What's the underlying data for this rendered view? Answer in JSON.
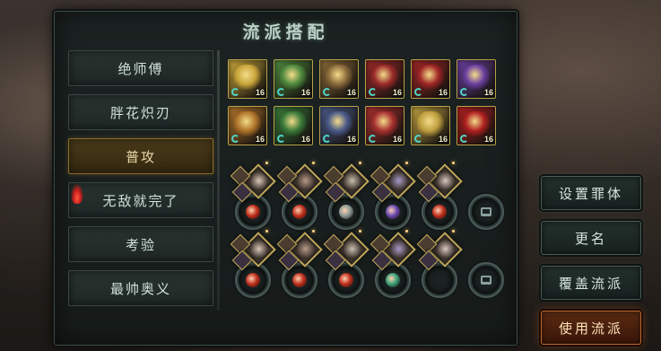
{
  "title": "流派搭配",
  "tabs": [
    "绝师傅",
    "胖花炽刃",
    "普攻",
    "无敌就完了",
    "考验",
    "最帅奥义"
  ],
  "active_tab": "普攻",
  "equipment": {
    "rows": [
      [
        {
          "name": "golden-bell-relic",
          "level": "16",
          "color": "#c9a63a"
        },
        {
          "name": "jade-gauntlet",
          "level": "16",
          "color": "#4f8a3e"
        },
        {
          "name": "bronze-armor",
          "level": "16",
          "color": "#8a6a3a"
        },
        {
          "name": "crimson-cloak",
          "level": "16",
          "color": "#9a2a2a"
        },
        {
          "name": "red-boots",
          "level": "16",
          "color": "#a02626"
        },
        {
          "name": "violet-serpent-ring",
          "level": "16",
          "color": "#6a3fa0"
        }
      ],
      [
        {
          "name": "amber-claw",
          "level": "16",
          "color": "#b0742a"
        },
        {
          "name": "emerald-robe",
          "level": "16",
          "color": "#3a7a3a"
        },
        {
          "name": "skull-necklace",
          "level": "16",
          "color": "#4a5a88"
        },
        {
          "name": "ruby-belt",
          "level": "16",
          "color": "#a83030"
        },
        {
          "name": "gilded-helm",
          "level": "16",
          "color": "#c0a040"
        },
        {
          "name": "scarlet-blade",
          "level": "16",
          "color": "#b02020"
        }
      ]
    ]
  },
  "skill_rows": [
    [
      {
        "core": "#c0301e",
        "has_card": true
      },
      {
        "core": "#c0301e",
        "has_card": true
      },
      {
        "core": "#8a9a96",
        "has_card": true
      },
      {
        "core": "#6a4ab0",
        "has_card": true
      },
      {
        "core": "#c0301e",
        "has_card": true
      },
      {
        "core": "",
        "has_card": false
      }
    ],
    [
      {
        "core": "#c0301e",
        "has_card": true
      },
      {
        "core": "#c0301e",
        "has_card": true
      },
      {
        "core": "#c0301e",
        "has_card": true
      },
      {
        "core": "#3aa07a",
        "has_card": true
      },
      {
        "core": "",
        "has_card": true
      },
      {
        "core": "",
        "has_card": false
      }
    ]
  ],
  "side_buttons": [
    "设置罪体",
    "更名",
    "覆盖流派",
    "使用流派"
  ]
}
